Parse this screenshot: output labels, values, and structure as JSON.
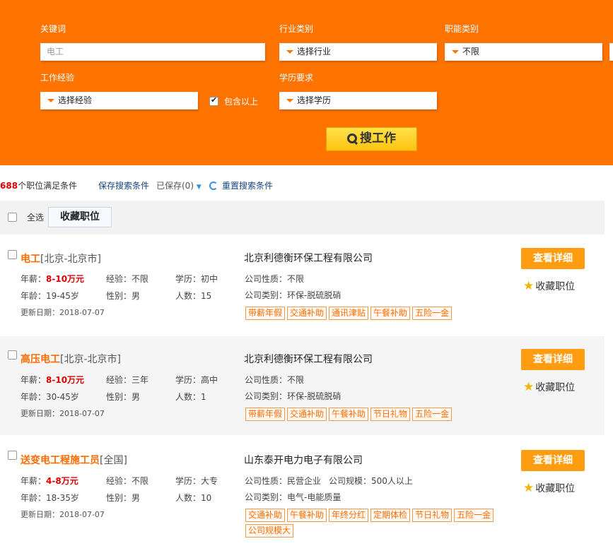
{
  "search": {
    "keyword_label": "关键词",
    "keyword_value": "电工",
    "industry_label": "行业类别",
    "industry_value": "选择行业",
    "function_label": "职能类别",
    "function_value": "不限",
    "experience_label": "工作经验",
    "experience_value": "选择经验",
    "include_above_label": "包含以上",
    "include_above_checked": true,
    "education_label": "学历要求",
    "education_value": "选择学历",
    "search_button": "搜工作"
  },
  "summary": {
    "count": "688",
    "count_suffix": "个职位满足条件",
    "save_search": "保存搜索条件",
    "saved": "已保存(0)",
    "reset_search": "重置搜索条件"
  },
  "toolbar": {
    "select_all": "全选",
    "collect": "收藏职位"
  },
  "labels": {
    "salary": "年薪：",
    "experience": "经验：",
    "education": "学历：",
    "age": "年龄：",
    "gender": "性别：",
    "headcount": "人数：",
    "update_date": "更新日期：",
    "company_nature": "公司性质：",
    "company_scale": "公司规模：",
    "company_type": "公司类别：",
    "detail_button": "查看详细",
    "favorite": "收藏职位"
  },
  "jobs": [
    {
      "title": "电工",
      "location": "[北京-北京市]",
      "salary": "8-10万元",
      "experience": "不限",
      "education": "初中",
      "age": "19-45岁",
      "gender": "男",
      "headcount": "15",
      "update_date": "2018-07-07",
      "company": "北京利德衡环保工程有限公司",
      "company_nature": "不限",
      "company_type": "环保-脱硫脱硝",
      "tags": [
        "带薪年假",
        "交通补助",
        "通讯津贴",
        "午餐补助",
        "五险一金"
      ]
    },
    {
      "title": "高压电工",
      "location": "[北京-北京市]",
      "salary": "8-10万元",
      "experience": "三年",
      "education": "高中",
      "age": "30-45岁",
      "gender": "男",
      "headcount": "1",
      "update_date": "2018-07-07",
      "company": "北京利德衡环保工程有限公司",
      "company_nature": "不限",
      "company_type": "环保-脱硫脱硝",
      "tags": [
        "带薪年假",
        "交通补助",
        "午餐补助",
        "节日礼物",
        "五险一金"
      ]
    },
    {
      "title": "送变电工程施工员",
      "location": "[全国]",
      "salary": "4-8万元",
      "experience": "不限",
      "education": "大专",
      "age": "18-35岁",
      "gender": "男",
      "headcount": "10",
      "update_date": "2018-07-07",
      "company": "山东泰开电力电子有限公司",
      "company_nature": "民营企业",
      "company_scale": "500人以上",
      "company_type": "电气-电能质量",
      "tags": [
        "交通补助",
        "午餐补助",
        "年终分红",
        "定期体检",
        "节日礼物",
        "五险一金",
        "公司规模大"
      ]
    }
  ],
  "colors": {
    "panel_orange": "#ff7400",
    "button_yellow": "#ffc210",
    "detail_orange": "#ff9c10",
    "title_orange": "#ff6c00",
    "salary_red": "#dd0000",
    "link_blue": "#14467e"
  }
}
